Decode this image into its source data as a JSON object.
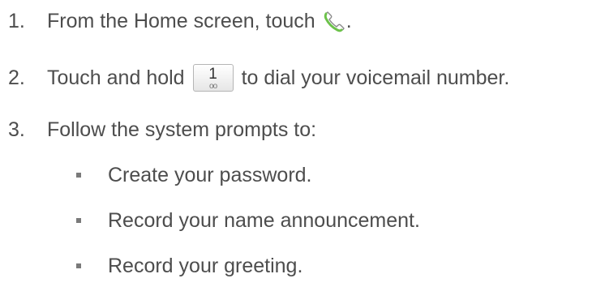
{
  "steps": [
    {
      "number": "1.",
      "text_before": "From the Home screen, touch",
      "text_after": "."
    },
    {
      "number": "2.",
      "text_before": "Touch and hold",
      "key_digit": "1",
      "key_sub": "oo",
      "text_after": "to dial your voicemail number."
    },
    {
      "number": "3.",
      "text": "Follow the system prompts to:"
    }
  ],
  "bullets": [
    "Create your password.",
    "Record your name announcement.",
    "Record your greeting."
  ],
  "icons": {
    "phone": "phone-icon",
    "voicemail_key": "voicemail-key-icon"
  },
  "colors": {
    "text": "#4d4d4d",
    "phone_green": "#6cc24a"
  }
}
